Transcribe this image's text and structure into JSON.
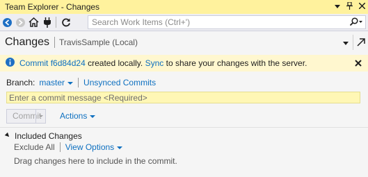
{
  "window": {
    "title": "Team Explorer - Changes",
    "controls": {
      "dropdown_icon": "dropdown-arrow-icon",
      "pin_icon": "pin-icon",
      "close_icon": "close-icon"
    }
  },
  "toolbar": {
    "buttons": [
      "back-icon",
      "forward-icon",
      "home-icon",
      "connect-icon",
      "refresh-icon"
    ],
    "search": {
      "placeholder": "Search Work Items (Ctrl+')"
    }
  },
  "header": {
    "title": "Changes",
    "subtitle": "TravisSample (Local)"
  },
  "infobar": {
    "prefix": "Commit",
    "commit_id": "f6d84d24",
    "middle": "created locally.",
    "sync_link": "Sync",
    "suffix": "to share your changes with the server."
  },
  "branch": {
    "label": "Branch:",
    "value": "master",
    "unsynced": "Unsynced Commits"
  },
  "commit": {
    "placeholder": "Enter a commit message <Required>",
    "button": "Commit",
    "actions": "Actions"
  },
  "included": {
    "title": "Included Changes",
    "exclude_all": "Exclude All",
    "view_options": "View Options",
    "hint": "Drag changes here to include in the commit."
  },
  "colors": {
    "title_bar": "#fff29d",
    "info_bar": "#fff7cf",
    "link": "#0e70c0",
    "commit_input": "#fff7b5"
  }
}
